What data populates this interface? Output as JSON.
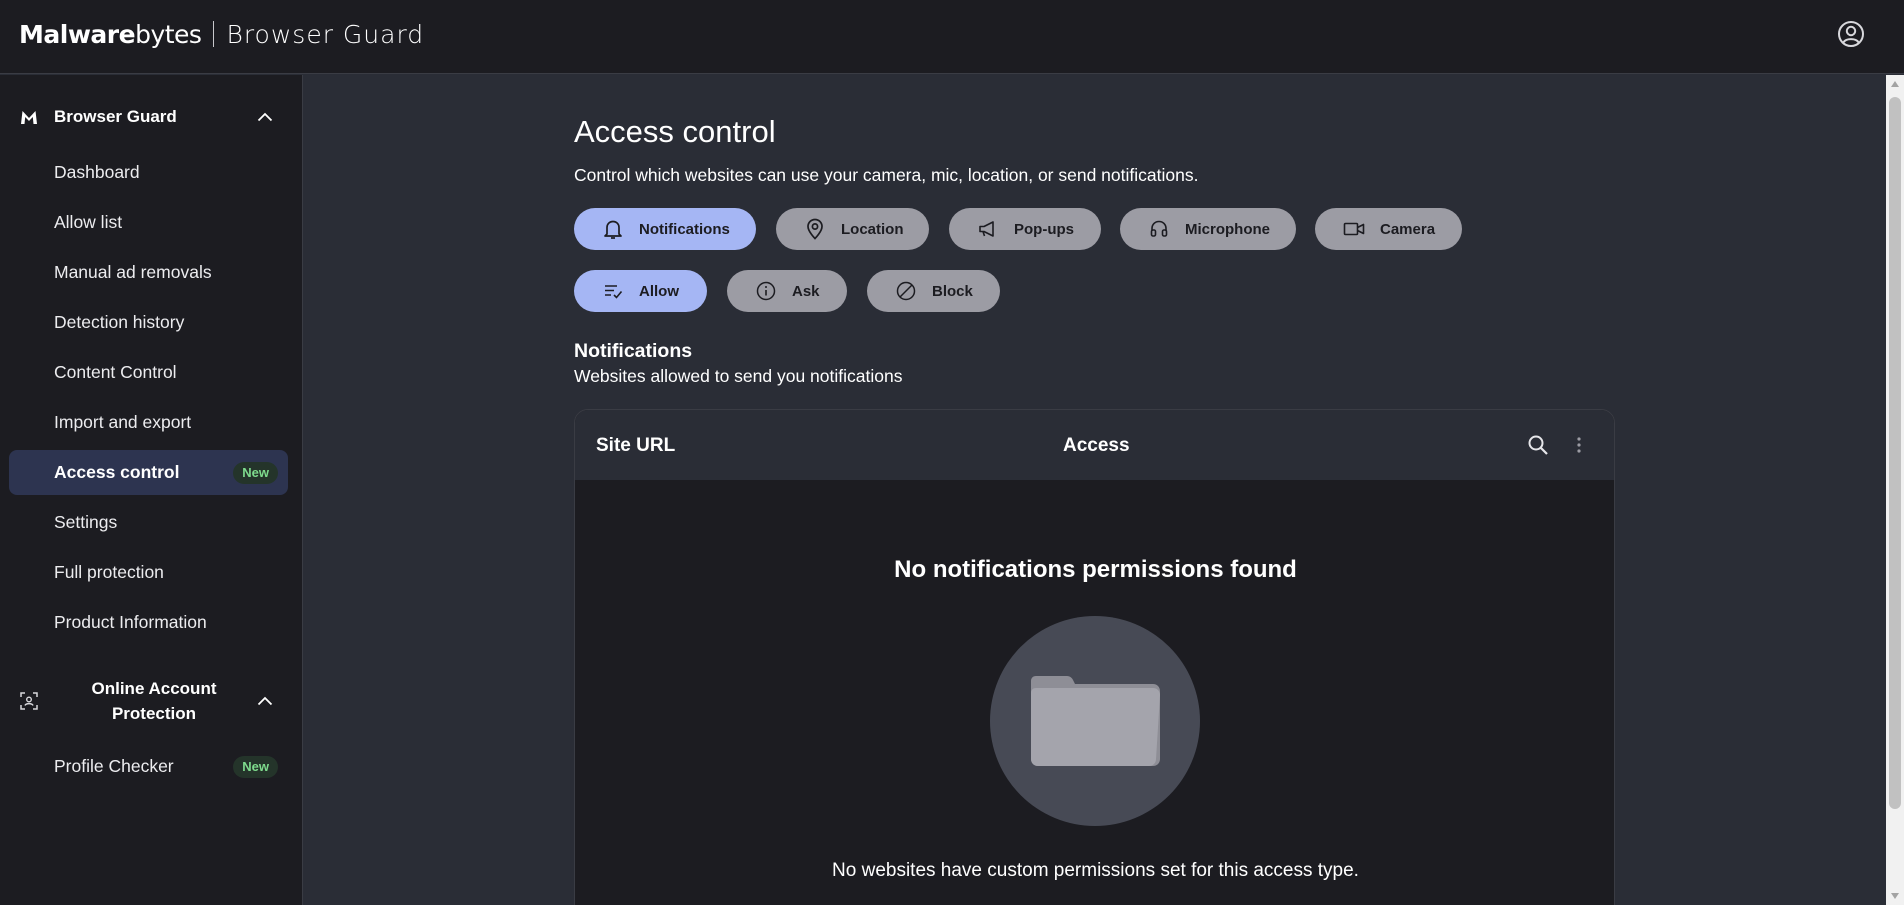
{
  "header": {
    "brand_bold": "Malware",
    "brand_light": "bytes",
    "product_name": "Browser Guard",
    "account_icon": "account-circle-icon"
  },
  "sidebar": {
    "sections": [
      {
        "title": "Browser Guard",
        "icon": "malwarebytes-logo-icon",
        "expanded": true,
        "items": [
          {
            "label": "Dashboard",
            "active": false
          },
          {
            "label": "Allow list",
            "active": false
          },
          {
            "label": "Manual ad removals",
            "active": false
          },
          {
            "label": "Detection history",
            "active": false
          },
          {
            "label": "Content Control",
            "active": false
          },
          {
            "label": "Import and export",
            "active": false
          },
          {
            "label": "Access control",
            "active": true,
            "badge": "New"
          },
          {
            "label": "Settings",
            "active": false
          },
          {
            "label": "Full protection",
            "active": false
          },
          {
            "label": "Product Information",
            "active": false
          }
        ]
      },
      {
        "title_line1": "Online Account",
        "title_line2": "Protection",
        "icon": "face-scan-icon",
        "expanded": true,
        "items": [
          {
            "label": "Profile Checker",
            "active": false,
            "badge": "New"
          }
        ]
      }
    ]
  },
  "main": {
    "title": "Access control",
    "description": "Control which websites can use your camera, mic, location, or send notifications.",
    "types": [
      {
        "label": "Notifications",
        "icon": "bell-icon",
        "selected": true
      },
      {
        "label": "Location",
        "icon": "location-pin-icon",
        "selected": false
      },
      {
        "label": "Pop-ups",
        "icon": "megaphone-icon",
        "selected": false
      },
      {
        "label": "Microphone",
        "icon": "headset-icon",
        "selected": false
      },
      {
        "label": "Camera",
        "icon": "video-camera-icon",
        "selected": false
      }
    ],
    "filters": [
      {
        "label": "Allow",
        "icon": "list-check-icon",
        "selected": true
      },
      {
        "label": "Ask",
        "icon": "info-icon",
        "selected": false
      },
      {
        "label": "Block",
        "icon": "block-icon",
        "selected": false
      }
    ],
    "section_title": "Notifications",
    "section_subtitle": "Websites allowed to send you notifications",
    "table": {
      "columns": [
        "Site URL",
        "Access"
      ],
      "rows": [],
      "empty_title": "No notifications permissions found",
      "empty_description": "No websites have custom permissions set for this access type."
    }
  },
  "colors": {
    "background": "#2a2d36",
    "sidebar": "#1c1c21",
    "chip_selected": "#a5b6f4",
    "chip_default": "#9c9ca4",
    "active_nav": "#2d3450",
    "badge_text": "#7edb8d"
  }
}
